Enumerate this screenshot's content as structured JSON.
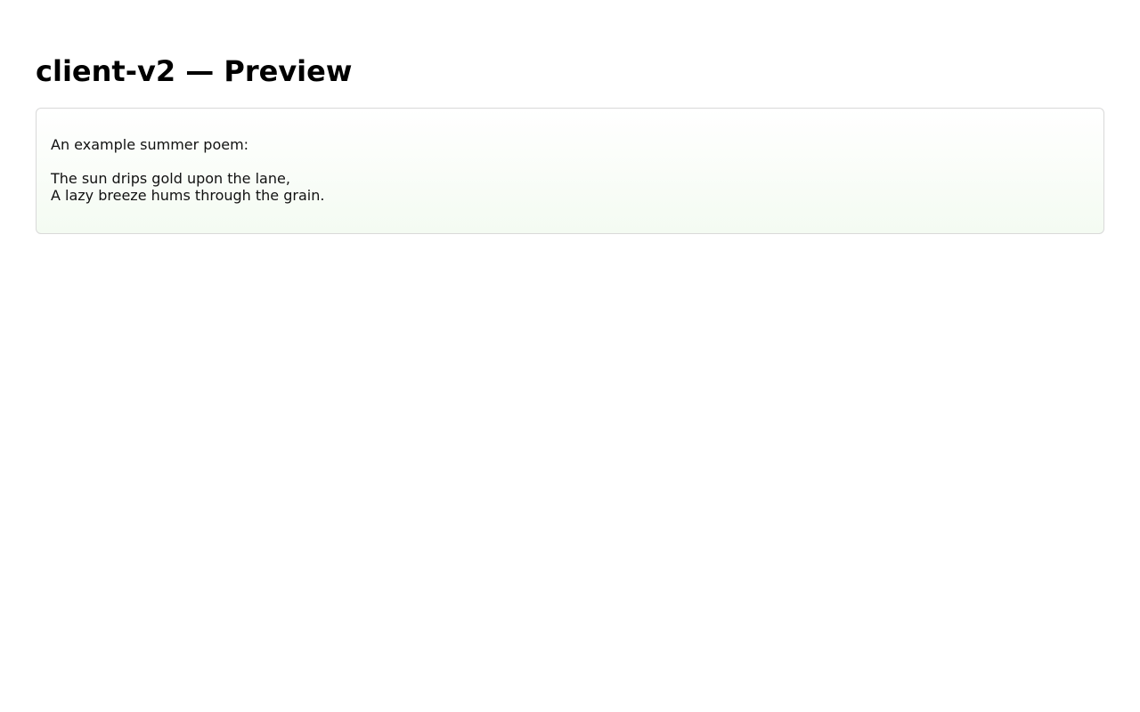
{
  "page": {
    "title": "client-v2 — Preview"
  },
  "preview": {
    "intro": "An example summer poem:",
    "poem_lines": [
      "The sun drips gold upon the lane,",
      "A lazy breeze hums through the grain."
    ]
  },
  "colors": {
    "background": "#ffffff",
    "card_border": "#d9d9d9",
    "card_gradient_bottom": "#f4fbf2",
    "text": "#111111"
  }
}
